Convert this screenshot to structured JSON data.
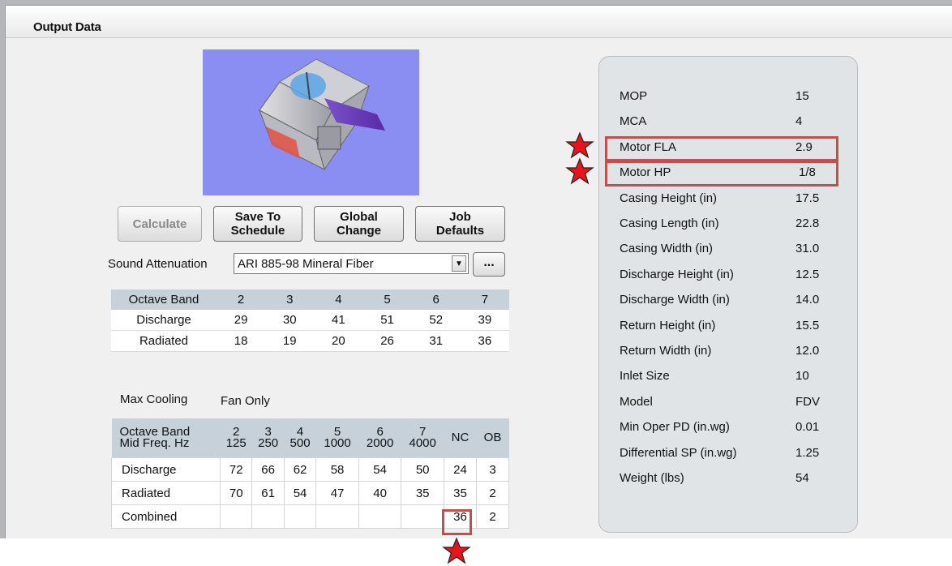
{
  "panel": {
    "title": "Output Data"
  },
  "buttons": {
    "calculate": "Calculate",
    "save_to_schedule": "Save To\nSchedule",
    "global_change": "Global\nChange",
    "job_defaults": "Job\nDefaults",
    "ellipsis": "..."
  },
  "sound_attenuation": {
    "label": "Sound Attenuation",
    "value": "ARI 885-98 Mineral Fiber"
  },
  "octave_table": {
    "header": [
      "Octave Band",
      "2",
      "3",
      "4",
      "5",
      "6",
      "7"
    ],
    "rows": [
      [
        "Discharge",
        "29",
        "30",
        "41",
        "51",
        "52",
        "39"
      ],
      [
        "Radiated",
        "18",
        "19",
        "20",
        "26",
        "31",
        "36"
      ]
    ]
  },
  "max_cooling": {
    "label": "Max Cooling",
    "value": "Fan Only"
  },
  "nc_table": {
    "header": [
      "Octave Band\nMid Freq. Hz",
      "2\n125",
      "3\n250",
      "4\n500",
      "5\n1000",
      "6\n2000",
      "7\n4000",
      "NC",
      "OB"
    ],
    "rows": [
      [
        "Discharge",
        "72",
        "66",
        "62",
        "58",
        "54",
        "50",
        "24",
        "3"
      ],
      [
        "Radiated",
        "70",
        "61",
        "54",
        "47",
        "40",
        "35",
        "35",
        "2"
      ],
      [
        "Combined",
        "",
        "",
        "",
        "",
        "",
        "",
        "36",
        "2"
      ]
    ]
  },
  "properties": [
    {
      "label": "MOP",
      "value": "15"
    },
    {
      "label": "MCA",
      "value": "4"
    },
    {
      "label": "Motor FLA",
      "value": "2.9"
    },
    {
      "label": "Motor HP",
      "value": "1/8"
    },
    {
      "label": "Casing Height (in)",
      "value": "17.5"
    },
    {
      "label": "Casing Length (in)",
      "value": "22.8"
    },
    {
      "label": "Casing Width (in)",
      "value": "31.0"
    },
    {
      "label": "Discharge Height (in)",
      "value": "12.5"
    },
    {
      "label": "Discharge Width (in)",
      "value": "14.0"
    },
    {
      "label": "Return Height (in)",
      "value": "15.5"
    },
    {
      "label": "Return Width (in)",
      "value": "12.0"
    },
    {
      "label": "Inlet Size",
      "value": "10"
    },
    {
      "label": "Model",
      "value": "FDV"
    },
    {
      "label": "Min Oper PD (in.wg)",
      "value": "0.01"
    },
    {
      "label": "Differential SP (in.wg)",
      "value": "1.25"
    },
    {
      "label": "Weight (lbs)",
      "value": "54"
    }
  ],
  "colors": {
    "highlight": "#c0504d",
    "star": "#e8141b",
    "table_header": "#c6d1d9",
    "image_bg": "#8a8ef3"
  }
}
